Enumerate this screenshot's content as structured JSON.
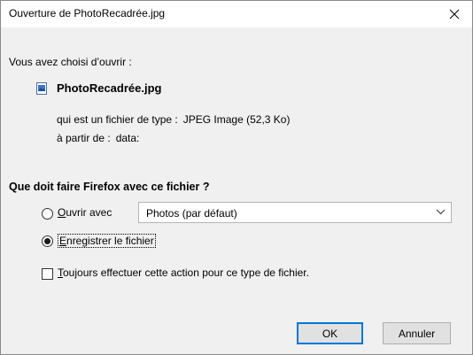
{
  "window": {
    "title": "Ouverture de PhotoRecadrée.jpg",
    "close_glyph": "×"
  },
  "body": {
    "chosen_label": "Vous avez choisi d’ouvrir :",
    "file_name": "PhotoRecadrée.jpg",
    "file_icon": "image-file-icon",
    "type_label": "qui est un fichier de type :",
    "type_value": "JPEG Image (52,3 Ko)",
    "from_label": "à partir de :",
    "from_value": "data:"
  },
  "action": {
    "question": "Que doit faire Firefox avec ce fichier ?",
    "open_with": {
      "mnemonic": "O",
      "label_rest": "uvrir avec",
      "checked": false
    },
    "app_select": {
      "selected": "Photos (par défaut)"
    },
    "save_file": {
      "mnemonic": "E",
      "label_rest": "nregistrer le fichier",
      "checked": true
    },
    "always": {
      "mnemonic": "T",
      "label_rest": "oujours effectuer cette action pour ce type de fichier.",
      "checked": false
    }
  },
  "buttons": {
    "ok": "OK",
    "cancel": "Annuler"
  },
  "colors": {
    "dialog_bg": "#f0f0f0",
    "titlebar_bg": "#ffffff",
    "default_button_border": "#0078d7"
  }
}
